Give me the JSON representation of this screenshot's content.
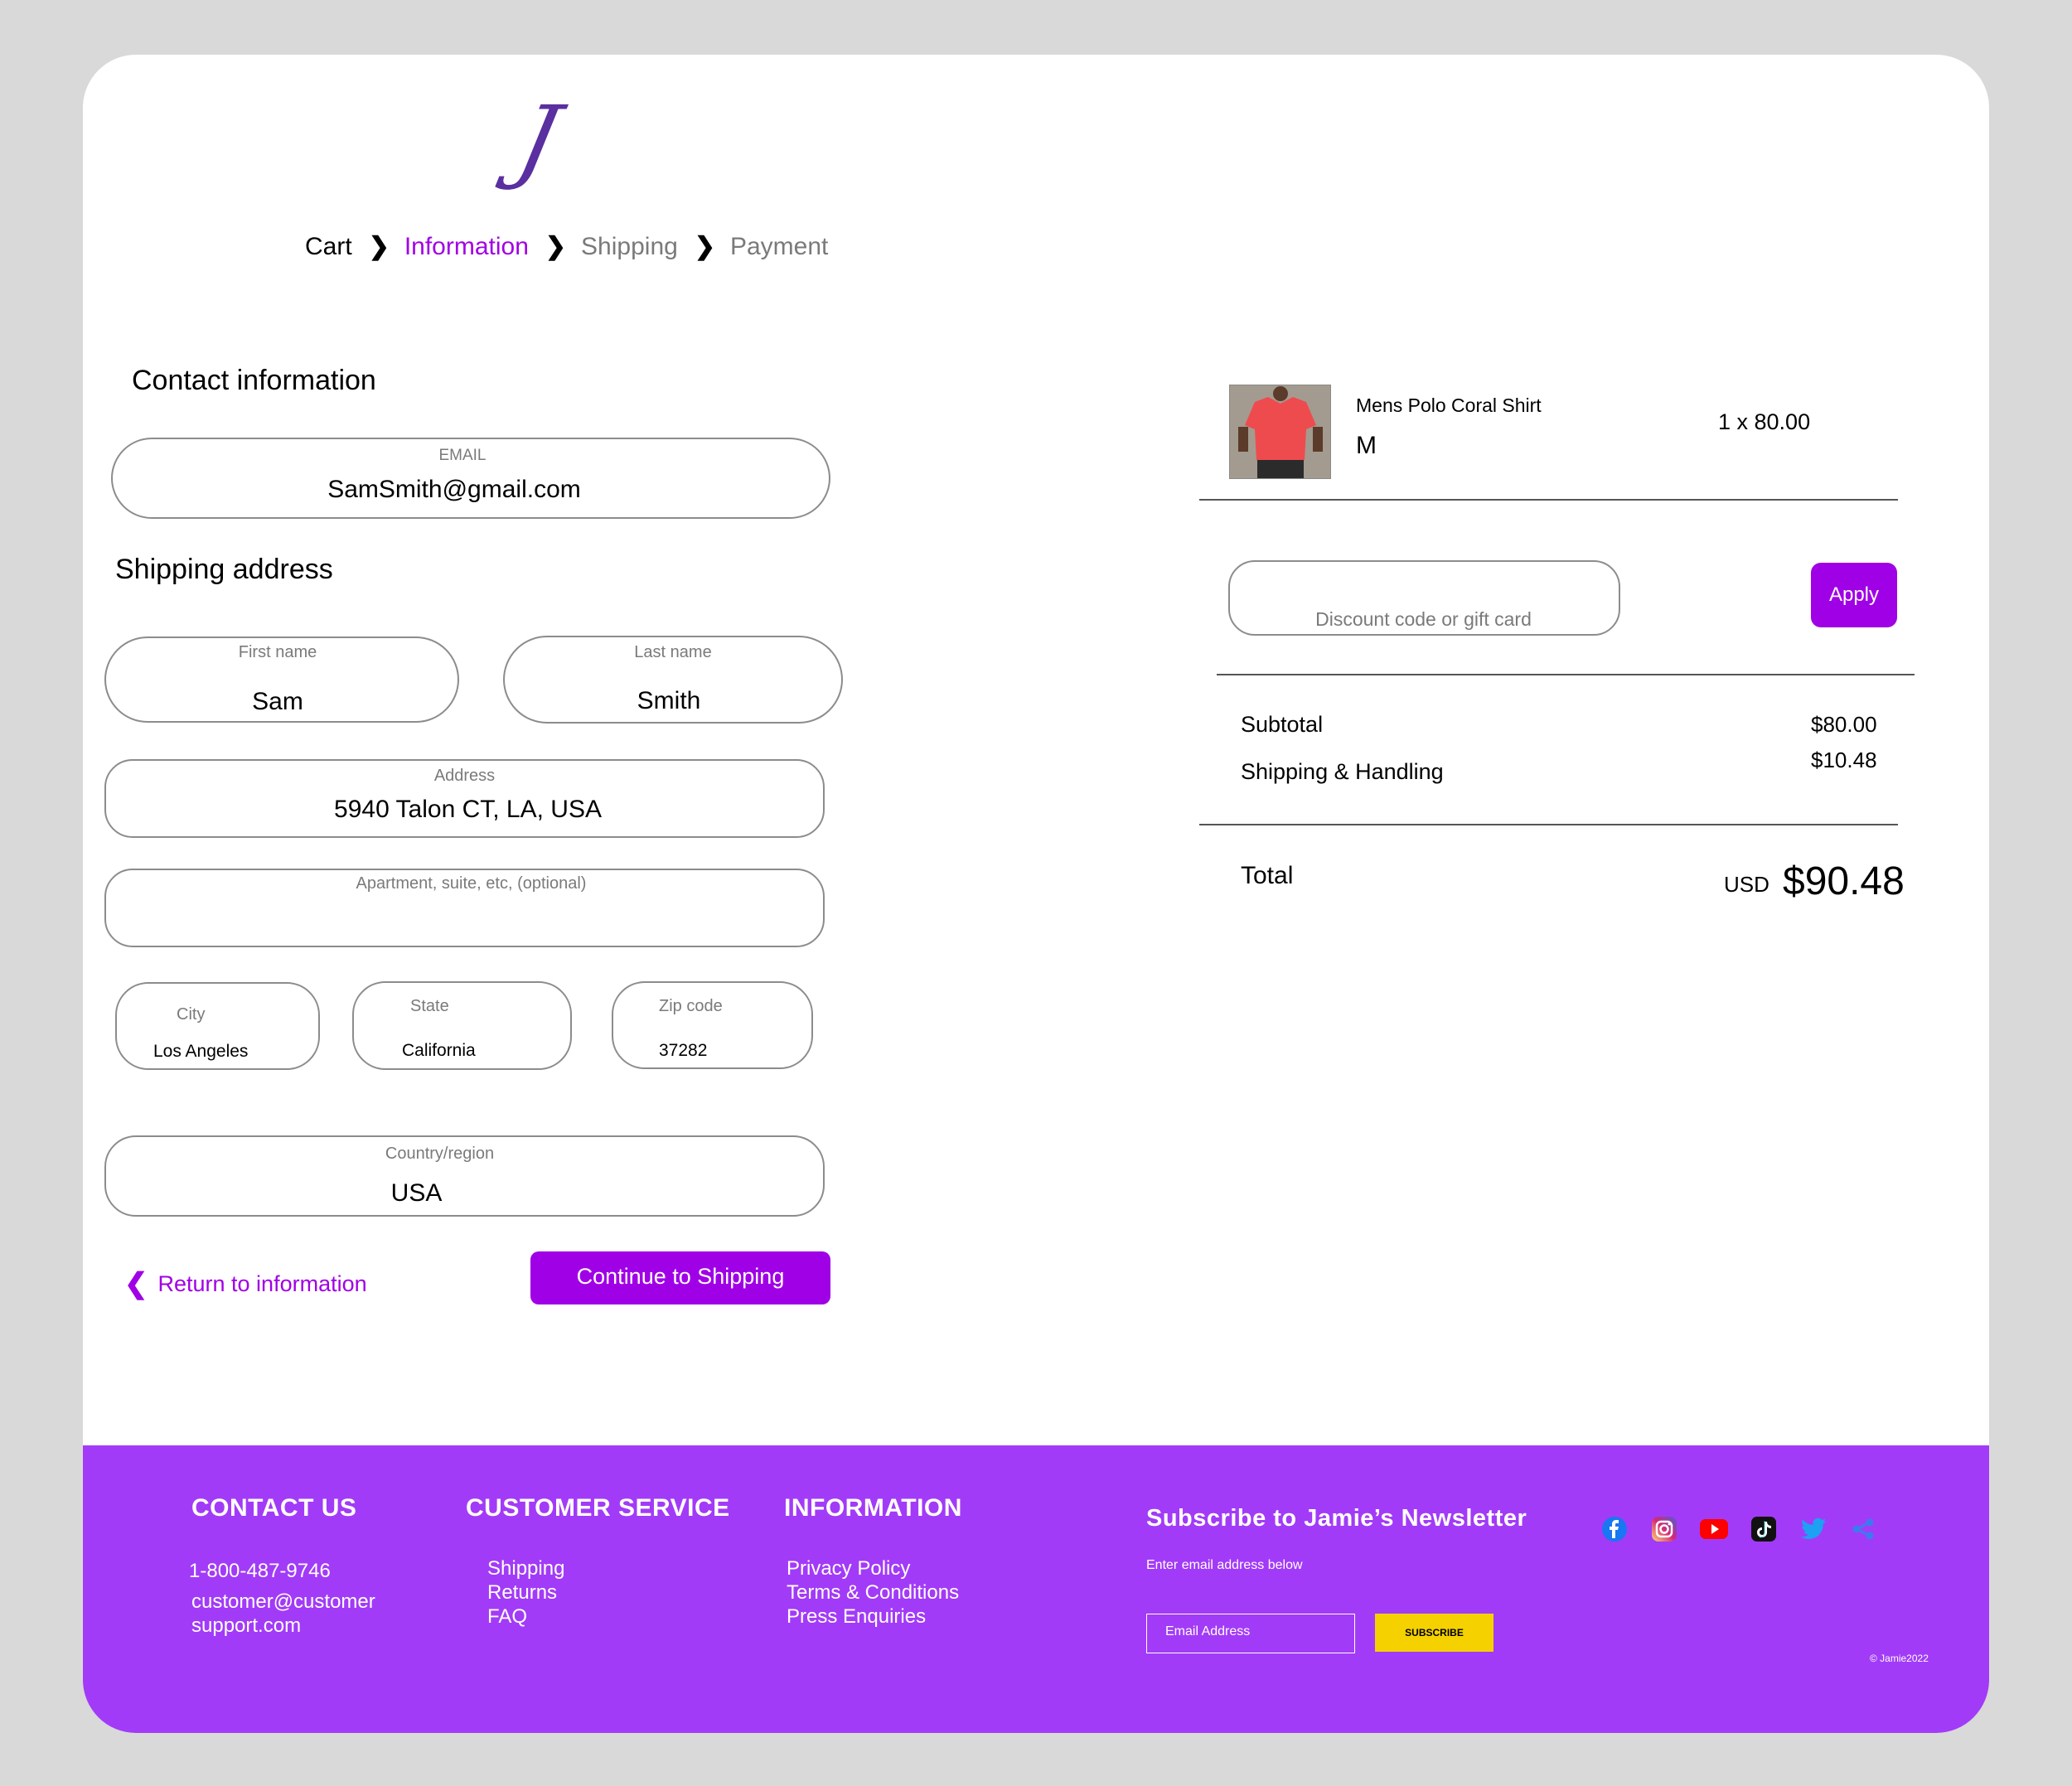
{
  "brand": {
    "logo_letter": "J"
  },
  "breadcrumb": [
    {
      "label": "Cart"
    },
    {
      "label": "Information"
    },
    {
      "label": "Shipping"
    },
    {
      "label": "Payment"
    }
  ],
  "breadcrumb_separator": "❯",
  "contact": {
    "heading": "Contact information",
    "email_label": "EMAIL",
    "email_value": "SamSmith@gmail.com"
  },
  "shipping": {
    "heading": "Shipping address",
    "first_name_label": "First name",
    "first_name_value": "Sam",
    "last_name_label": "Last name",
    "last_name_value": "Smith",
    "address_label": "Address",
    "address_value": "5940 Talon CT, LA, USA",
    "apartment_label": "Apartment, suite, etc, (optional)",
    "city_label": "City",
    "city_value": "Los Angeles",
    "state_label": "State",
    "state_value": "California",
    "zip_label": "Zip code",
    "zip_value": "37282",
    "country_label": "Country/region",
    "country_value": "USA"
  },
  "actions": {
    "return_icon": "❮",
    "return_label": "Return to information",
    "continue_label": "Continue to Shipping"
  },
  "order": {
    "item_name": "Mens Polo Coral Shirt",
    "item_size": "M",
    "item_qty_price": "1 x 80.00",
    "discount_placeholder": "Discount code or gift card",
    "apply_label": "Apply",
    "subtotal_label": "Subtotal",
    "subtotal_value": "$80.00",
    "shipping_label": "Shipping & Handling",
    "shipping_value": "$10.48",
    "total_label": "Total",
    "currency": "USD",
    "total_value": "$90.48"
  },
  "footer": {
    "contact_heading": "CONTACT US",
    "phone": "1-800-487-9746",
    "email_line1": "customer@customer",
    "email_line2": "support.com",
    "service_heading": "CUSTOMER SERVICE",
    "service_links": [
      "Shipping",
      "Returns",
      "FAQ"
    ],
    "info_heading": "INFORMATION",
    "info_links": [
      "Privacy Policy",
      "Terms & Conditions",
      "Press Enquiries"
    ],
    "newsletter_heading": "Subscribe to Jamie’s Newsletter",
    "newsletter_sub": "Enter email address below",
    "email_placeholder": "Email Address",
    "subscribe_label": "SUBSCRIBE",
    "copyright": "© Jamie2022",
    "social_icons": [
      "facebook-icon",
      "instagram-icon",
      "youtube-icon",
      "tiktok-icon",
      "twitter-icon",
      "share-icon"
    ]
  },
  "colors": {
    "accent": "#a000e6",
    "footer_bg": "#a23bf7",
    "subscribe_bg": "#f5d100"
  }
}
